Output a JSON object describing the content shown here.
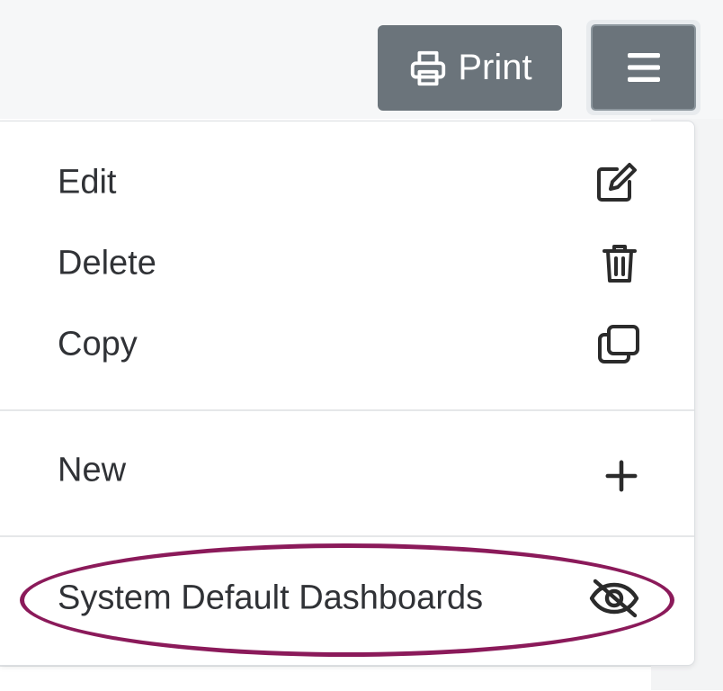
{
  "toolbar": {
    "print_label": "Print",
    "print_icon": "printer-icon",
    "menu_icon": "hamburger-icon"
  },
  "menu": {
    "items": [
      {
        "label": "Edit",
        "icon": "edit-icon"
      },
      {
        "label": "Delete",
        "icon": "trash-icon"
      },
      {
        "label": "Copy",
        "icon": "copy-icon"
      },
      {
        "label": "New",
        "icon": "plus-icon"
      },
      {
        "label": "System Default Dashboards",
        "icon": "eye-slash-icon"
      }
    ]
  },
  "annotation": {
    "color": "#8b1a5a"
  },
  "colors": {
    "button_bg": "#6b747b",
    "topbar_bg": "#f6f7f8"
  }
}
